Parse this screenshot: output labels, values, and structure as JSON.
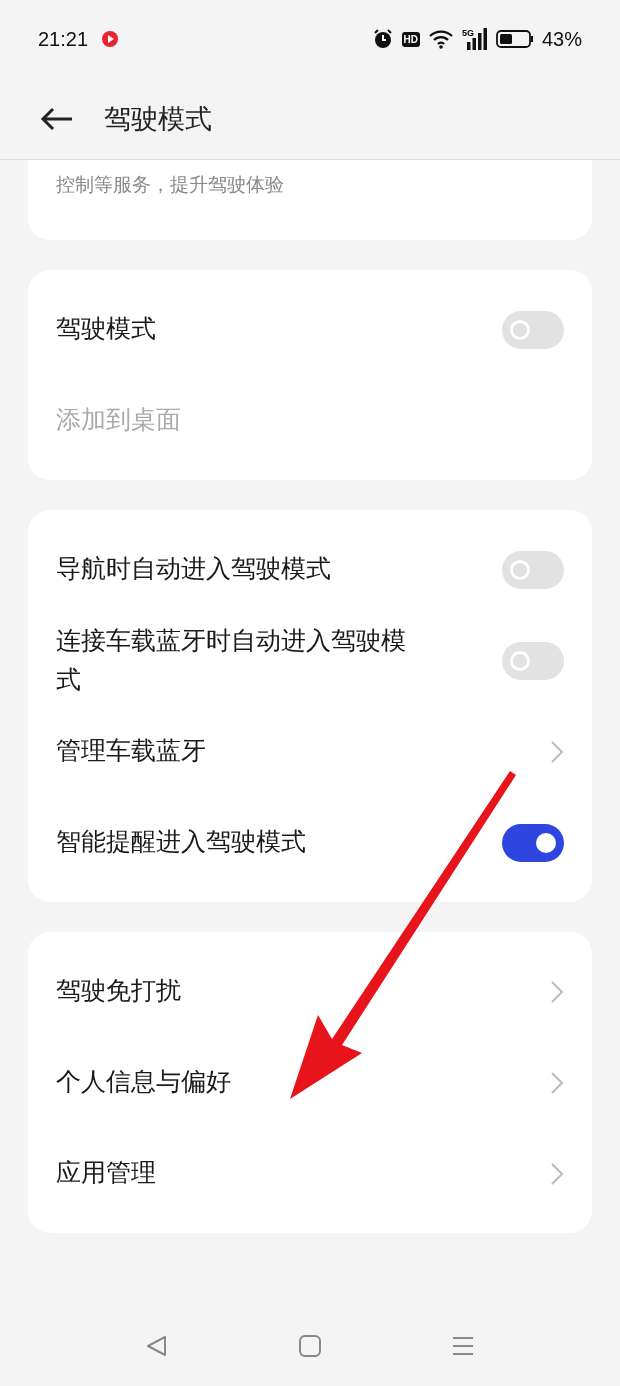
{
  "status_bar": {
    "time": "21:21",
    "hd": "HD",
    "network": "5G",
    "battery": "43%"
  },
  "header": {
    "title": "驾驶模式"
  },
  "intro": {
    "text": "控制等服务，提升驾驶体验"
  },
  "groups": [
    {
      "items": [
        {
          "kind": "toggle",
          "label": "驾驶模式",
          "on": false,
          "disabled": false
        },
        {
          "kind": "text",
          "label": "添加到桌面",
          "disabled": true
        }
      ]
    },
    {
      "items": [
        {
          "kind": "toggle",
          "label": "导航时自动进入驾驶模式",
          "on": false,
          "disabled": false
        },
        {
          "kind": "toggle",
          "label": "连接车载蓝牙时自动进入驾驶模式",
          "on": false,
          "disabled": false
        },
        {
          "kind": "link",
          "label": "管理车载蓝牙",
          "disabled": false
        },
        {
          "kind": "toggle",
          "label": "智能提醒进入驾驶模式",
          "on": true,
          "disabled": false
        }
      ]
    },
    {
      "items": [
        {
          "kind": "link",
          "label": "驾驶免打扰",
          "disabled": false
        },
        {
          "kind": "link",
          "label": "个人信息与偏好",
          "disabled": false
        },
        {
          "kind": "link",
          "label": "应用管理",
          "disabled": false
        }
      ]
    }
  ]
}
